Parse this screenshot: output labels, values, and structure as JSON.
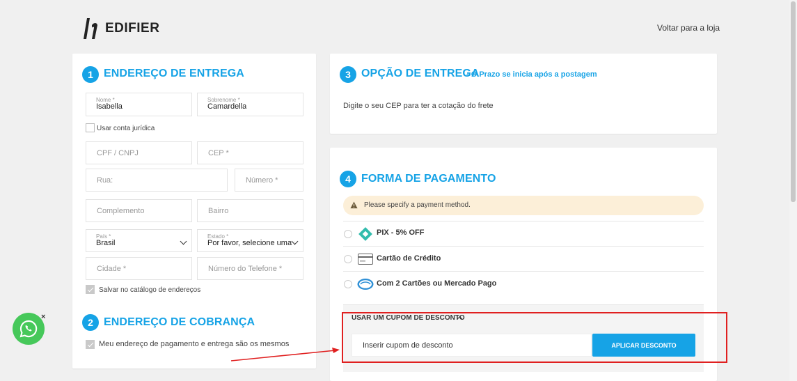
{
  "header": {
    "brand": "EDIFIER",
    "back_link": "Voltar para a loja"
  },
  "shipping_address": {
    "step": "1",
    "title": "ENDEREÇO DE ENTREGA",
    "first_name": {
      "label": "Nome *",
      "value": "Isabella"
    },
    "last_name": {
      "label": "Sobrenome *",
      "value": "Camardella"
    },
    "company_checkbox": "Usar conta jurídica",
    "cpf_placeholder": "CPF / CNPJ",
    "cep_placeholder": "CEP *",
    "street_placeholder": "Rua:",
    "number_placeholder": "Número *",
    "complement_placeholder": "Complemento",
    "district_placeholder": "Bairro",
    "country": {
      "label": "País *",
      "value": "Brasil"
    },
    "state": {
      "label": "Estado *",
      "value": "Por favor, selecione uma re..."
    },
    "city_placeholder": "Cidade *",
    "phone_placeholder": "Número do Telefone *",
    "save_checkbox": "Salvar no catálogo de endereços"
  },
  "billing_address": {
    "step": "2",
    "title": "ENDEREÇO DE COBRANÇA",
    "same_checkbox": "Meu endereço de pagamento e entrega são os mesmos"
  },
  "delivery_option": {
    "step": "3",
    "title": "OPÇÃO DE ENTREGA",
    "subtitle": "- O Prazo se inicia após a postagem",
    "message": "Digite o seu CEP para ter a cotação do frete"
  },
  "payment": {
    "step": "4",
    "title": "FORMA DE PAGAMENTO",
    "alert": "Please specify a payment method.",
    "methods": [
      {
        "label": "PIX - 5% OFF",
        "icon": "pix-icon"
      },
      {
        "label": "Cartão de Crédito",
        "icon": "credit-card-icon"
      },
      {
        "label": "Com 2 Cartões ou Mercado Pago",
        "icon": "mercado-pago-icon"
      }
    ],
    "coupon": {
      "toggle_label": "USAR UM CUPOM DE DESCONTO",
      "placeholder": "Inserir cupom de desconto",
      "apply_label": "APLICAR DESCONTO"
    }
  },
  "colors": {
    "accent": "#16a3e6",
    "alert_bg": "#fcefd8",
    "annotation": "#e02020",
    "whatsapp": "#46c85a"
  }
}
